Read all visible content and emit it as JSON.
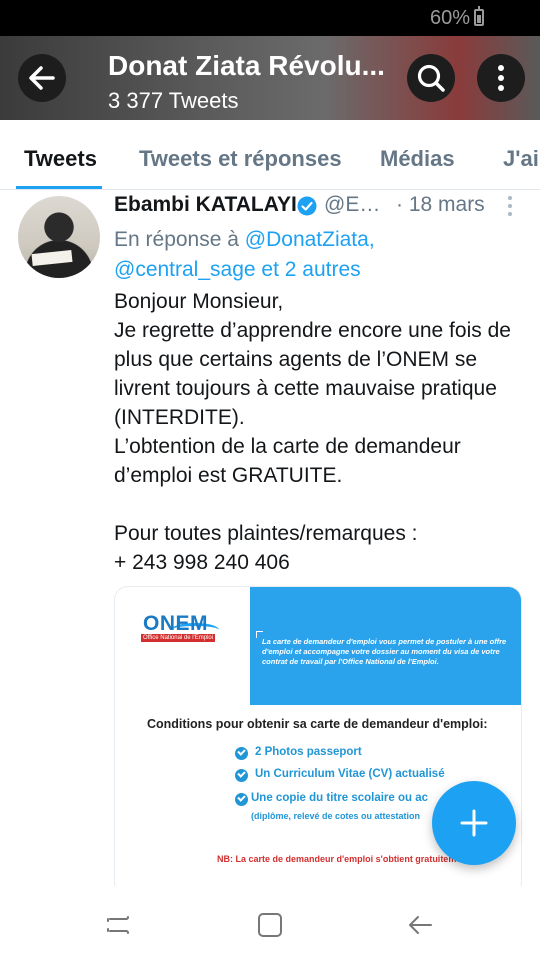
{
  "status_bar": {
    "battery_text": "60%"
  },
  "header": {
    "title": "Donat Ziata Révolu...",
    "subtitle": "3 377 Tweets",
    "icons": [
      "back-arrow-icon",
      "search-icon",
      "more-vertical-icon"
    ]
  },
  "tabs": [
    {
      "label": "Tweets",
      "active": true
    },
    {
      "label": "Tweets et réponses",
      "active": false
    },
    {
      "label": "Médias",
      "active": false
    },
    {
      "label": "J'aime",
      "active": false
    }
  ],
  "tweet": {
    "author": "Ebambi KATALAYI",
    "handle": "@Eb...",
    "date": "· 18 mars",
    "reply_prefix": "En réponse à",
    "reply_mention_1": "@DonatZiata,",
    "reply_mention_2": "@central_sage",
    "reply_suffix": "et 2 autres",
    "body_lines": [
      "Bonjour Monsieur,",
      "Je regrette d’apprendre encore une fois de",
      "plus que certains agents de l’ONEM se",
      "livrent toujours à cette mauvaise pratique",
      "(INTERDITE).",
      "L’obtention de la carte de demandeur",
      "d’emploi est GRATUITE.",
      "",
      "Pour toutes plaintes/remarques :",
      "+ 243 998 240 406"
    ],
    "media": {
      "logo_text": "ONEM",
      "logo_subtext": "Office National de l'Emploi",
      "panel_text": "La carte de demandeur d'emploi vous permet de postuler à une offre d'emploi et accompagne votre dossier au moment du visa de votre contrat de travail par l'Office National de l'Emploi.",
      "conditions_title": "Conditions pour obtenir sa carte de demandeur d'emploi:",
      "conditions": [
        "2 Photos passeport",
        "Un Curriculum Vitae (CV) actualisé",
        "Une copie du titre scolaire ou ac"
      ],
      "condition_detail": "(diplôme, relevé de cotes ou attestation",
      "note": "NB: La carte de demandeur d'emploi s'obtient gratuitement"
    }
  },
  "colors": {
    "accent": "#1da1f2",
    "text_secondary": "#657786",
    "note_red": "#d32f2f"
  }
}
